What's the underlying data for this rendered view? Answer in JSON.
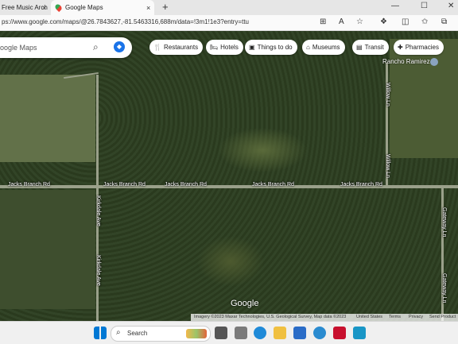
{
  "browser": {
    "tabs": [
      {
        "title": "Free Music Arch",
        "close": "×"
      },
      {
        "title": "Google Maps",
        "close": "×"
      }
    ],
    "new_tab_symbol": "+",
    "url": "ps://www.google.com/maps/@26.7843627,-81.5463316,688m/data=!3m1!1e3?entry=ttu"
  },
  "map": {
    "search_placeholder": "oogle Maps",
    "chips": [
      {
        "icon": "restaurant-icon",
        "label": "Restaurants"
      },
      {
        "icon": "hotel-icon",
        "label": "Hotels"
      },
      {
        "icon": "camera-icon",
        "label": "Things to do"
      },
      {
        "icon": "museum-icon",
        "label": "Museums"
      },
      {
        "icon": "transit-icon",
        "label": "Transit"
      },
      {
        "icon": "pharmacy-icon",
        "label": "Pharmacies"
      }
    ],
    "place_label": "Rancho Ramirez",
    "road_labels": {
      "jacks_1": "Jacks Branch Rd",
      "jacks_2": "Jacks Branch Rd",
      "jacks_3": "Jacks Branch Rd",
      "jacks_4": "Jacks Branch Rd",
      "jacks_5": "Jacks Branch Rd",
      "kirkdale_1": "Kirkdale Ave",
      "kirkdale_2": "Kirkdale Ave",
      "willow_1": "Willow Ln",
      "willow_2": "Willow Ln",
      "gateway_1": "Gateway Ln",
      "gateway_2": "Gateway Ln"
    },
    "logo": "Google",
    "footer": {
      "imagery": "Imagery ©2023 Maxar Technologies, U.S. Geological Survey, Map data ©2023",
      "country": "United States",
      "terms": "Terms",
      "privacy": "Privacy",
      "feedback": "Send Product"
    }
  },
  "taskbar": {
    "search_label": "Search"
  }
}
